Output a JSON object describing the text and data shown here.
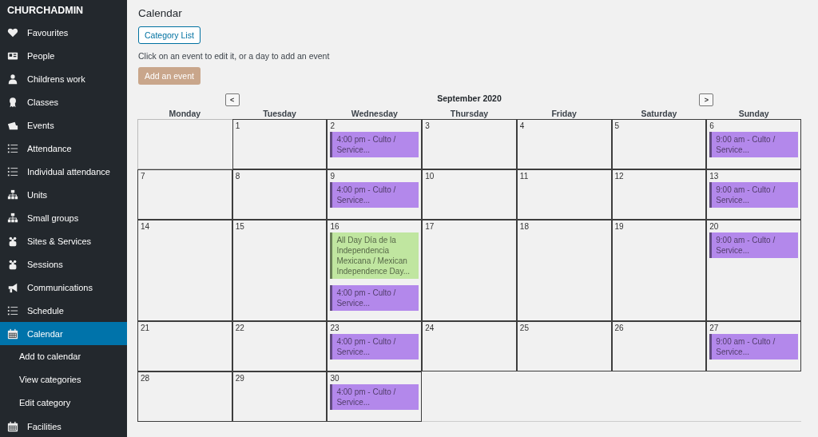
{
  "sidebar": {
    "brand": "CHURCHADMIN",
    "items": [
      {
        "label": "Favourites",
        "kind": "heart",
        "selected": false
      },
      {
        "label": "People",
        "kind": "card",
        "selected": false
      },
      {
        "label": "Childrens work",
        "kind": "person",
        "selected": false
      },
      {
        "label": "Classes",
        "kind": "award",
        "selected": false
      },
      {
        "label": "Events",
        "kind": "tickets",
        "selected": false
      },
      {
        "label": "Attendance",
        "kind": "list",
        "selected": false
      },
      {
        "label": "Individual attendance",
        "kind": "list",
        "selected": false
      },
      {
        "label": "Units",
        "kind": "sitemap",
        "selected": false
      },
      {
        "label": "Small groups",
        "kind": "sitemap",
        "selected": false
      },
      {
        "label": "Sites & Services",
        "kind": "group",
        "selected": false
      },
      {
        "label": "Sessions",
        "kind": "group",
        "selected": false
      },
      {
        "label": "Communications",
        "kind": "megaphone",
        "selected": false
      },
      {
        "label": "Schedule",
        "kind": "list",
        "selected": false
      },
      {
        "label": "Calendar",
        "kind": "calendar",
        "selected": true,
        "children": [
          {
            "label": "Add to calendar",
            "selected": false
          },
          {
            "label": "View categories",
            "selected": false
          },
          {
            "label": "Edit category",
            "selected": false
          }
        ]
      },
      {
        "label": "Facilities",
        "kind": "calendar",
        "selected": false
      }
    ]
  },
  "page": {
    "title": "Calendar",
    "category_button": "Category List",
    "hint": "Click on an event to edit it, or a day to add an event",
    "add_button": "Add an event"
  },
  "calendar": {
    "prev": "<",
    "title": "September 2020",
    "next": ">",
    "weekdays": [
      "Monday",
      "Tuesday",
      "Wednesday",
      "Thursday",
      "Friday",
      "Saturday",
      "Sunday"
    ],
    "weeks": [
      {
        "cells": [
          {
            "kind": "blank"
          },
          {
            "kind": "day",
            "day": "1"
          },
          {
            "kind": "day",
            "day": "2",
            "events": [
              {
                "text": "4:00 pm - Culto / Service...",
                "color": "#b388eb"
              }
            ]
          },
          {
            "kind": "day",
            "day": "3"
          },
          {
            "kind": "day",
            "day": "4"
          },
          {
            "kind": "day",
            "day": "5"
          },
          {
            "kind": "day",
            "day": "6",
            "events": [
              {
                "text": "9:00 am - Culto / Service...",
                "color": "#b388eb"
              }
            ]
          }
        ]
      },
      {
        "cells": [
          {
            "kind": "day",
            "day": "7"
          },
          {
            "kind": "day",
            "day": "8"
          },
          {
            "kind": "day",
            "day": "9",
            "events": [
              {
                "text": "4:00 pm - Culto / Service...",
                "color": "#b388eb"
              }
            ]
          },
          {
            "kind": "day",
            "day": "10"
          },
          {
            "kind": "day",
            "day": "11"
          },
          {
            "kind": "day",
            "day": "12"
          },
          {
            "kind": "day",
            "day": "13",
            "events": [
              {
                "text": "9:00 am - Culto / Service...",
                "color": "#b388eb"
              }
            ]
          }
        ]
      },
      {
        "cells": [
          {
            "kind": "day",
            "day": "14"
          },
          {
            "kind": "day",
            "day": "15"
          },
          {
            "kind": "day",
            "day": "16",
            "events": [
              {
                "text": "All Day Día de la Independencia Mexicana / Mexican Independence Day...",
                "color": "#c0e6a0"
              },
              {
                "text": "4:00 pm - Culto / Service...",
                "color": "#b388eb"
              }
            ]
          },
          {
            "kind": "day",
            "day": "17"
          },
          {
            "kind": "day",
            "day": "18"
          },
          {
            "kind": "day",
            "day": "19"
          },
          {
            "kind": "day",
            "day": "20",
            "events": [
              {
                "text": "9:00 am - Culto / Service...",
                "color": "#b388eb"
              }
            ]
          }
        ]
      },
      {
        "cells": [
          {
            "kind": "day",
            "day": "21"
          },
          {
            "kind": "day",
            "day": "22"
          },
          {
            "kind": "day",
            "day": "23",
            "events": [
              {
                "text": "4:00 pm - Culto / Service...",
                "color": "#b388eb"
              }
            ]
          },
          {
            "kind": "day",
            "day": "24"
          },
          {
            "kind": "day",
            "day": "25"
          },
          {
            "kind": "day",
            "day": "26"
          },
          {
            "kind": "day",
            "day": "27",
            "events": [
              {
                "text": "9:00 am - Culto / Service...",
                "color": "#b388eb"
              }
            ]
          }
        ]
      },
      {
        "cells": [
          {
            "kind": "day",
            "day": "28"
          },
          {
            "kind": "day",
            "day": "29"
          },
          {
            "kind": "day",
            "day": "30",
            "events": [
              {
                "text": "4:00 pm - Culto / Service...",
                "color": "#b388eb"
              }
            ]
          },
          {
            "kind": "blank"
          },
          {
            "kind": "blank"
          },
          {
            "kind": "blank"
          },
          {
            "kind": "blank"
          }
        ]
      }
    ]
  }
}
